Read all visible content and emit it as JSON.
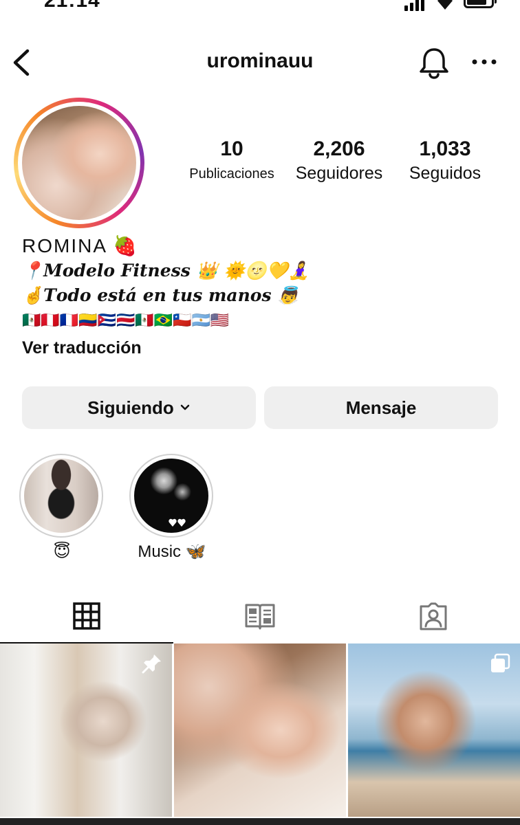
{
  "status_bar": {
    "time": "21:14"
  },
  "header": {
    "username": "urominauu"
  },
  "profile": {
    "stats": [
      {
        "value": "10",
        "label": "Publicaciones"
      },
      {
        "value": "2,206",
        "label": "Seguidores"
      },
      {
        "value": "1,033",
        "label": "Seguidos"
      }
    ],
    "bio": {
      "name": "ROMINA 🍓",
      "line1": "📍𝑴𝒐𝒅𝒆𝒍𝒐 𝑭𝒊𝒕𝒏𝒆𝒔𝒔 👑 🌞🌝💛🧘‍♀️",
      "line2": "🤞𝑻𝒐𝒅𝒐 𝒆𝒔𝒕á 𝒆𝒏 𝒕𝒖𝒔 𝒎𝒂𝒏𝒐𝒔 👼",
      "flags": "🇲🇽🇵🇪🇫🇷🇨🇴🇨🇺🇨🇷🇲🇽🇧🇷🇨🇱🇦🇷🇺🇸",
      "translate": "Ver traducción"
    }
  },
  "actions": {
    "following": "Siguiendo",
    "message": "Mensaje"
  },
  "highlights": [
    {
      "caption": "😇"
    },
    {
      "caption": "Music 🦋"
    }
  ]
}
